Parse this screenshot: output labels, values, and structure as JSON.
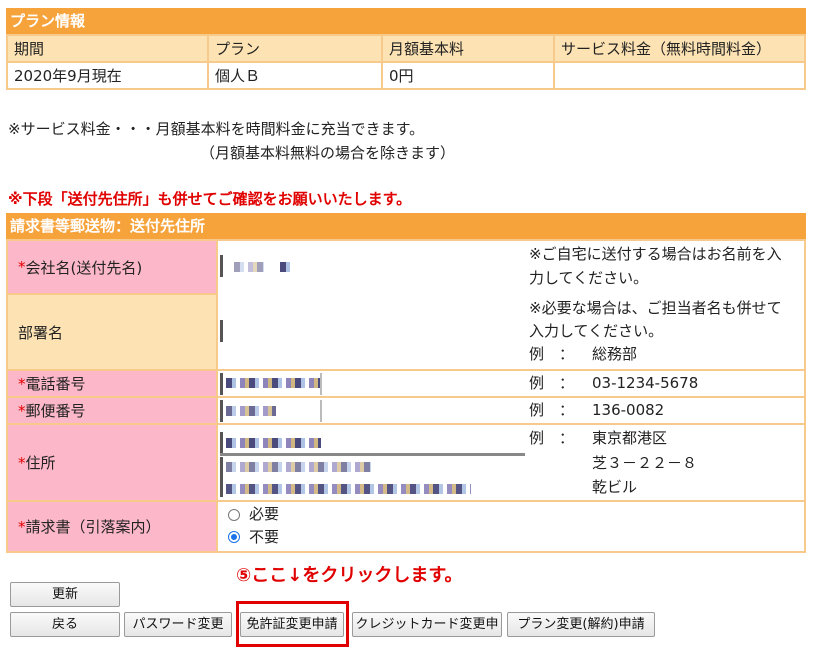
{
  "plan_section": {
    "title": "プラン情報",
    "headers": [
      "期間",
      "プラン",
      "月額基本料",
      "サービス料金（無料時間料金）"
    ],
    "row": [
      "2020年9月現在",
      "個人Ｂ",
      "0円",
      ""
    ]
  },
  "notes": {
    "line1": "※サービス料金・・・月額基本料を時間料金に充当できます。",
    "line2": "（月額基本料無料の場合を除きます）",
    "warning": "※下段「送付先住所」も併せてご確認をお願いいたします。"
  },
  "address_section": {
    "title": "請求書等郵送物：送付先住所",
    "required_mark": "*",
    "fields": {
      "company": {
        "label": "会社名(送付先名)",
        "hint1": "※ご自宅に送付する場合はお名前を入",
        "hint2": "力してください。"
      },
      "department": {
        "label": "部署名",
        "hint1": "※必要な場合は、ご担当者名も併せて",
        "hint2": "入力してください。",
        "example_prefix": "例　：",
        "example": "総務部"
      },
      "phone": {
        "label": "電話番号",
        "example_prefix": "例　：",
        "example": "03-1234-5678"
      },
      "postal": {
        "label": "郵便番号",
        "example_prefix": "例　：",
        "example": "136-0082"
      },
      "address": {
        "label": "住所",
        "example_prefix": "例　：",
        "example1": "東京都港区",
        "example2": "芝３－２２－８",
        "example3": "乾ビル"
      },
      "invoice": {
        "label": "請求書（引落案内）",
        "options": [
          "必要",
          "不要"
        ],
        "selected": "不要"
      }
    }
  },
  "instruction": "⑤ここ↓をクリックします。",
  "buttons": {
    "update": "更新",
    "back": "戻る",
    "password": "パスワード変更",
    "license": "免許証変更申請",
    "credit": "クレジットカード変更申",
    "plan_change": "プラン変更(解約)申請"
  },
  "colors": {
    "accent": "#f7a33b",
    "label_bg": "#fcb8c9",
    "highlight": "#e00000"
  }
}
